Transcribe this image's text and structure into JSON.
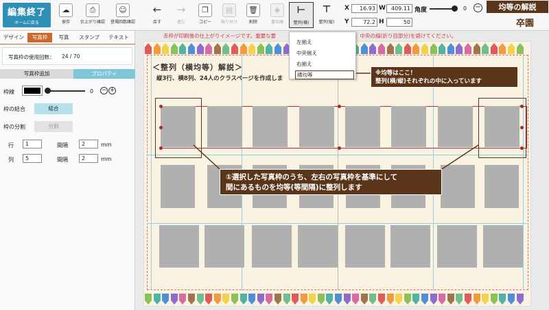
{
  "toolbar": {
    "exit_label": "編集終了",
    "exit_sub": "ホームに戻る",
    "save": "保存",
    "preview": "仕上がり確認",
    "count_check": "登場回数確認",
    "back": "戻す",
    "forward": "進む",
    "copy": "コピー",
    "paste": "貼り付け",
    "delete": "削除",
    "stack": "重ね順",
    "align_h": "整列(横)",
    "align_v": "整列(縦)",
    "x_label": "X",
    "x_value": "16.93",
    "w_label": "W",
    "w_value": "409.11",
    "y_label": "Y",
    "y_value": "72.2",
    "h_label": "H",
    "h_value": "50",
    "angle_label": "角度",
    "angle_value": "0",
    "brand": "卒園"
  },
  "title_badge": "均等の解説",
  "left": {
    "tabs": [
      "デザイン",
      "写真枠",
      "写真",
      "スタンプ",
      "テキスト"
    ],
    "usage_label": "写真枠の使用回数：",
    "usage_value": "24 / 70",
    "subtabs": [
      "写真枠追加",
      "プロパティ"
    ],
    "border_label": "枠線",
    "border_value": "0",
    "merge_label": "枠の結合",
    "merge_button": "結合",
    "split_label": "枠の分割",
    "split_button": "分割",
    "row_label": "行",
    "row_value": "1",
    "col_label": "列",
    "col_value": "5",
    "gap_label": "間隔",
    "gap_row_value": "2",
    "gap_col_value": "2",
    "unit": "mm"
  },
  "canvas": {
    "notice": "赤枠が印刷後の仕上がりイメージです。重要な要素は内側の赤枠の内側に入れ、中央の線(折り目部分)を避けて配置してください。",
    "notice_visible": "赤枠が印刷後の仕上がりイメージです。重要な要",
    "notice_tail": "の内側に入れ、中央の線(折り目部分)を避けてください。",
    "heading": "＜整列（横均等）解説＞",
    "subheading": "縦3行、横8列、24人のクラスページを作成しま"
  },
  "dropdown": {
    "items": [
      "左揃え",
      "中央揃え",
      "右揃え",
      "横均等"
    ]
  },
  "callouts": {
    "top_line1": "※均等はここ！",
    "top_line2": "整列(横/縦)それぞれの中に入っています",
    "bottom_line1": "①選択した写真枠のうち、左右の写真枠を基準にして",
    "bottom_line2": "間にあるものを均等(等間隔)に整列します"
  },
  "colors": {
    "accent_blue": "#2f8fb6",
    "tab_orange": "#c9692e",
    "callout_brown": "#5a3519",
    "frame_red": "#b3283a"
  }
}
